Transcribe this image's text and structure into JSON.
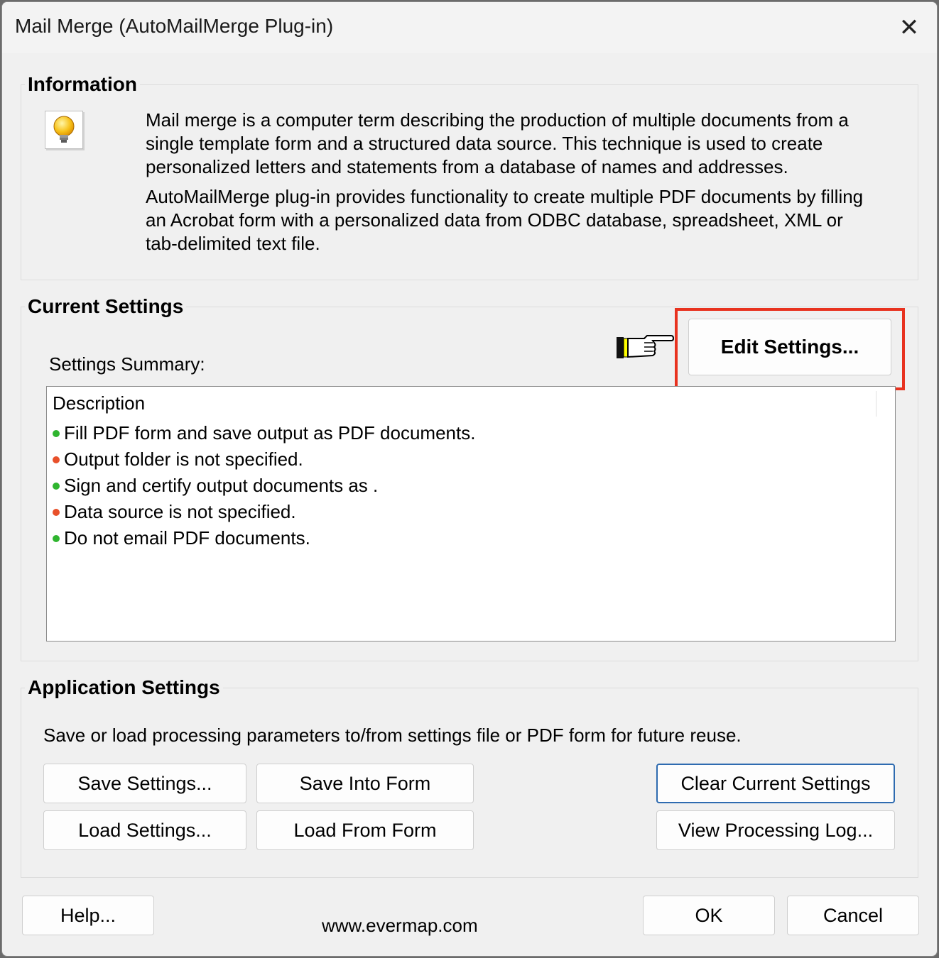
{
  "window": {
    "title": "Mail Merge (AutoMailMerge Plug-in)",
    "close_label": "✕"
  },
  "information": {
    "heading": "Information",
    "icon": "lightbulb-icon",
    "paragraph1_lines": [
      "Mail merge is a computer term describing the production of multiple documents from a",
      "single template form and a structured data source. This technique is used to create",
      "personalized letters and statements from a database of names and addresses."
    ],
    "paragraph2_lines": [
      "AutoMailMerge plug-in provides functionality to create multiple PDF documents by filling",
      "an Acrobat form with a personalized data from ODBC database, spreadsheet, XML or",
      "tab-delimited text file."
    ]
  },
  "current_settings": {
    "heading": "Current Settings",
    "edit_button": "Edit Settings...",
    "summary_label": "Settings Summary:",
    "summary_header": "Description",
    "items": [
      {
        "text": "Fill PDF form and save output as PDF documents.",
        "status": "ok"
      },
      {
        "text": "Output folder is not specified.",
        "status": "error"
      },
      {
        "text": "Sign and certify output documents as .",
        "status": "ok"
      },
      {
        "text": "Data source is not specified.",
        "status": "error"
      },
      {
        "text": "Do not email PDF documents.",
        "status": "ok"
      }
    ],
    "colors": {
      "ok": "#2fb52f",
      "error": "#e8502a",
      "highlight": "#e8321f"
    }
  },
  "application_settings": {
    "heading": "Application Settings",
    "description": "Save or load processing parameters to/from settings file or PDF form for future reuse.",
    "save_settings": "Save Settings...",
    "save_into_form": "Save Into Form",
    "clear_current": "Clear Current Settings",
    "load_settings": "Load Settings...",
    "load_from_form": "Load From Form",
    "view_log": "View Processing Log..."
  },
  "footer": {
    "help": "Help...",
    "website": "www.evermap.com",
    "ok": "OK",
    "cancel": "Cancel"
  }
}
